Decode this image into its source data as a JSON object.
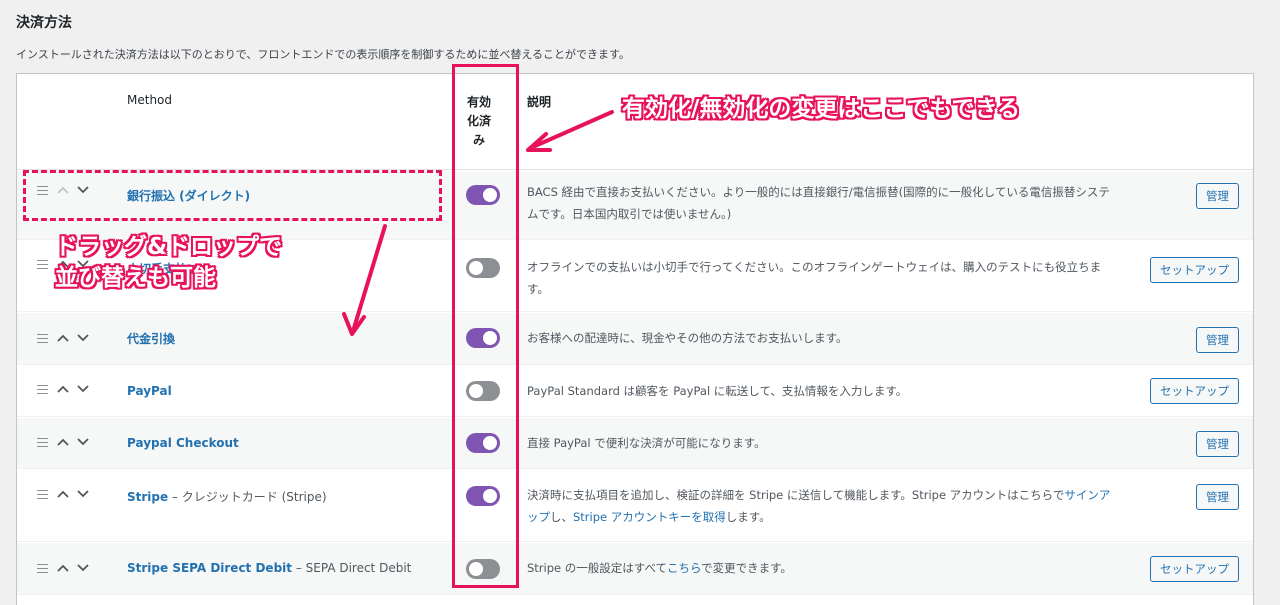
{
  "page": {
    "title": "決済方法",
    "description": "インストールされた決済方法は以下のとおりで、フロントエンドでの表示順序を制御するために並べ替えることができます。"
  },
  "columns": {
    "method": "Method",
    "enabled": "有効化済み",
    "enabled_lines": [
      "有効",
      "化済",
      "み"
    ],
    "description": "説明"
  },
  "rows": [
    {
      "name": "銀行振込 (ダイレクト)",
      "sub": "",
      "enabled": true,
      "desc": "BACS 経由で直接お支払いください。より一般的には直接銀行/電信振替(国際的に一般化している電信振替システムです。日本国内取引では使いません。)",
      "button": "管理"
    },
    {
      "name": "小切手支払い",
      "sub": "",
      "enabled": false,
      "desc": "オフラインでの支払いは小切手で行ってください。このオフラインゲートウェイは、購入のテストにも役立ちます。",
      "button": "セットアップ"
    },
    {
      "name": "代金引換",
      "sub": "",
      "enabled": true,
      "desc": "お客様への配達時に、現金やその他の方法でお支払いします。",
      "button": "管理"
    },
    {
      "name": "PayPal",
      "sub": "",
      "enabled": false,
      "desc": "PayPal Standard は顧客を PayPal に転送して、支払情報を入力します。",
      "button": "セットアップ"
    },
    {
      "name": "Paypal Checkout",
      "sub": "",
      "enabled": true,
      "desc": "直接 PayPal で便利な決済が可能になります。",
      "button": "管理"
    },
    {
      "name": "Stripe",
      "sub": " – クレジットカード (Stripe)",
      "enabled": true,
      "desc_parts": [
        "決済時に支払項目を追加し、検証の詳細を Stripe に送信して機能します。Stripe アカウントはこちらで",
        "サインアップ",
        "し、",
        "Stripe アカウントキーを取得",
        "します。"
      ],
      "button": "管理"
    },
    {
      "name": "Stripe SEPA Direct Debit",
      "sub": " – SEPA Direct Debit",
      "enabled": false,
      "desc_parts": [
        "Stripe の一般設定はすべて",
        "こちら",
        "で変更できます。"
      ],
      "button": "セットアップ"
    }
  ],
  "annotations": {
    "toggle_note": "有効化/無効化の変更はここでもできる",
    "drag_note_line1": "ドラッグ&ドロップで",
    "drag_note_line2": "並び替えも可能",
    "accent_color": "#e8115b"
  },
  "colors": {
    "toggle_on": "#7f54b3",
    "toggle_off": "#8c8f94",
    "link": "#2271b1"
  }
}
